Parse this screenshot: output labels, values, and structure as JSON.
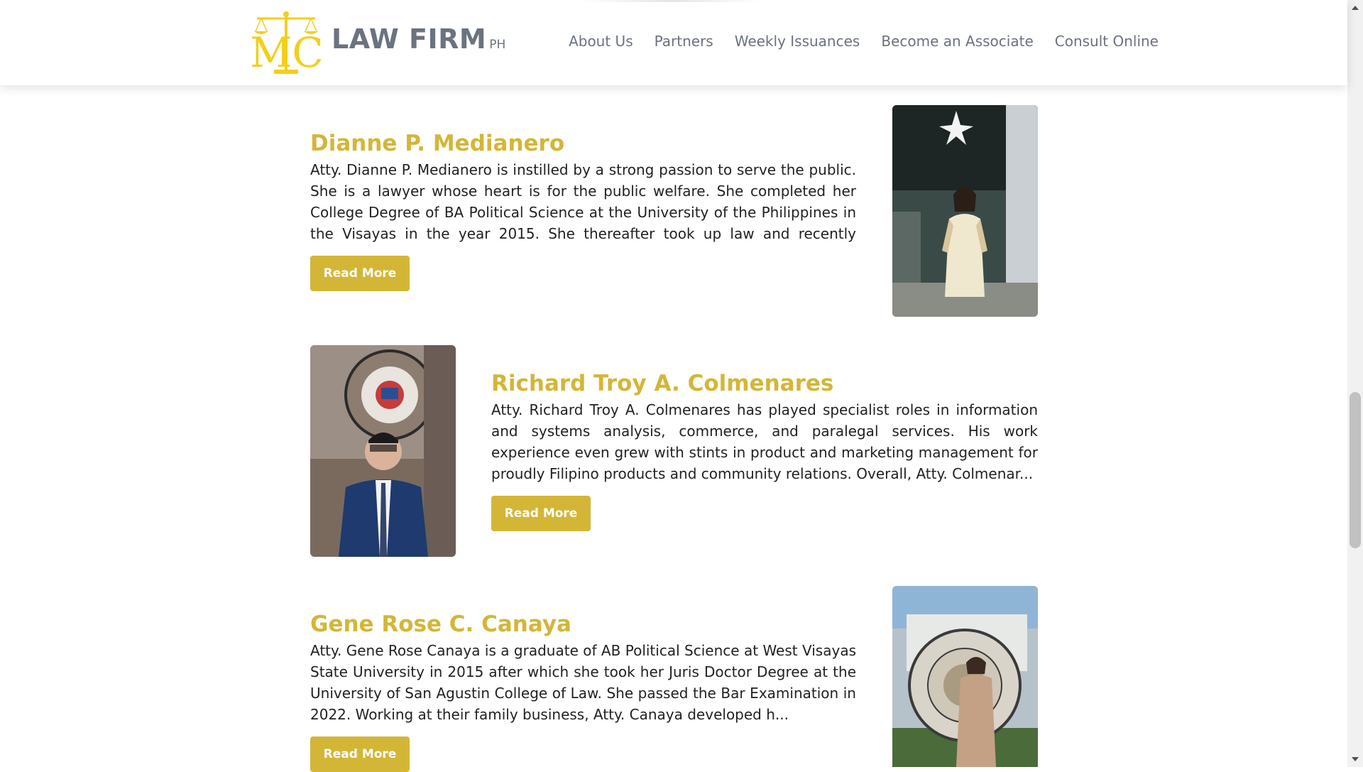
{
  "header": {
    "brand_name": "LAW FIRM",
    "brand_suffix": "PH",
    "logo_letters": "MC",
    "nav": [
      {
        "label": "About Us"
      },
      {
        "label": "Partners"
      },
      {
        "label": "Weekly Issuances"
      },
      {
        "label": "Become an Associate"
      },
      {
        "label": "Consult Online"
      }
    ]
  },
  "profiles": [
    {
      "name": "Dianne P. Medianero",
      "bio": "Atty. Dianne P. Medianero is instilled by a strong passion to serve the public. She is a lawyer whose heart is for the public welfare. She completed her College Degree of BA Political Science at the University of the Philippines in the Visayas in the year 2015. She thereafter took up law and recently passe...",
      "button_label": "Read More",
      "photo_description": "portrait-woman-cream-dress"
    },
    {
      "name": "Richard Troy A. Colmenares",
      "bio": "Atty. Richard Troy A. Colmenares has played specialist roles in information and systems analysis, commerce, and paralegal services. His work experience even grew with stints in product and marketing management for proudly Filipino products and community relations. Overall, Atty. Colmenar...",
      "button_label": "Read More",
      "photo_description": "portrait-man-blue-suit"
    },
    {
      "name": "Gene Rose C. Canaya",
      "bio": "Atty. Gene Rose Canaya is a graduate of AB Political Science at West Visayas State University in 2015 after which she took her Juris Doctor Degree at the University of San Agustin College of Law. She passed the Bar Examination in 2022. Working at their family business, Atty. Canaya developed h...",
      "button_label": "Read More",
      "photo_description": "portrait-woman-supreme-court-seal"
    }
  ],
  "colors": {
    "accent": "#d4b637",
    "nav_text": "#6b7280",
    "body_text": "#222222"
  }
}
